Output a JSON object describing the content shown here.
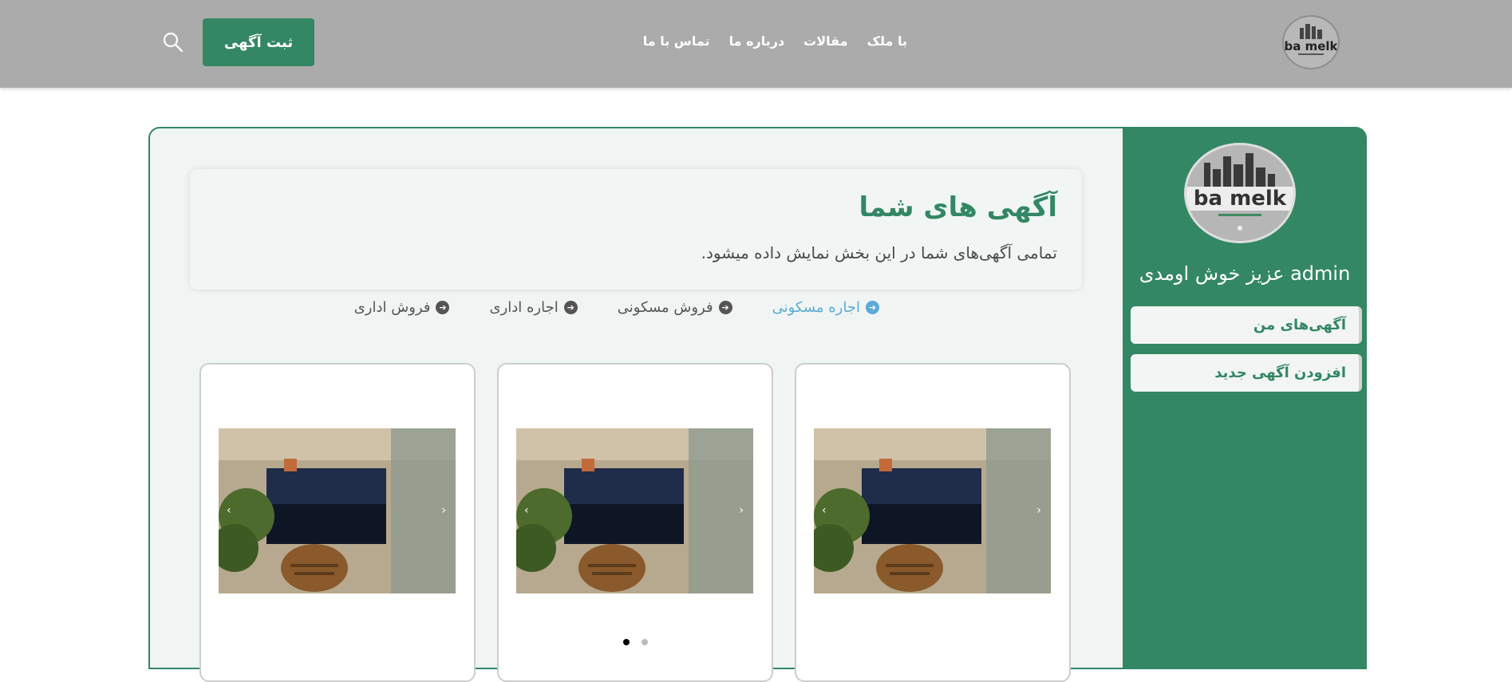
{
  "header": {
    "logo_text": "ba melk",
    "nav": [
      "با ملک",
      "مقالات",
      "درباره ما",
      "تماس با ما"
    ],
    "post_button": "ثبت آگهی",
    "icons": {
      "search": "search-icon"
    }
  },
  "main": {
    "title": "آگهی های شما",
    "subtitle": "تمامی آگهی‌های شما در این بخش نمایش داده میشود.",
    "filters": [
      {
        "label": "اجاره مسکونی",
        "active": true
      },
      {
        "label": "فروش مسکونی",
        "active": false
      },
      {
        "label": "اجاره اداری",
        "active": false
      },
      {
        "label": "فروش اداری",
        "active": false
      }
    ],
    "cards_count": 3,
    "carousel_pages": 2,
    "carousel_active_index": 0
  },
  "sidebar": {
    "logo_text": "ba melk",
    "welcome": "admin عزیز خوش اومدی",
    "items": [
      "آگهی‌های من",
      "افزودن آگهی جدید"
    ]
  },
  "colors": {
    "header_bg": "#ababab",
    "brand_green": "#338764",
    "active_filter": "#5aaad6",
    "panel_bg": "#f0f5f3"
  }
}
